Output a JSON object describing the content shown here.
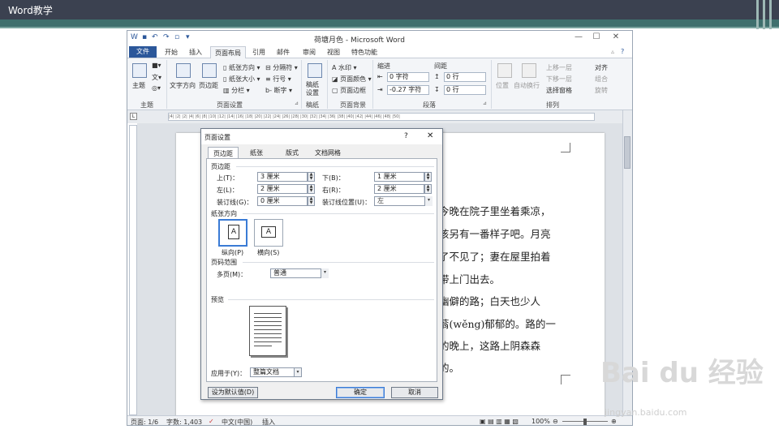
{
  "slide": {
    "title": "Word教学"
  },
  "word": {
    "window_title": "荷塘月色 - Microsoft Word",
    "tabs": [
      "文件",
      "开始",
      "插入",
      "页面布局",
      "引用",
      "邮件",
      "审阅",
      "视图",
      "特色功能"
    ],
    "active_tab": "页面布局",
    "ribbon": {
      "theme": {
        "themes": "主题",
        "group": "主题"
      },
      "page_setup": {
        "text_direction": "文字方向",
        "margins": "页边距",
        "orientation": "纸张方向",
        "size": "纸张大小",
        "columns": "分栏",
        "breaks": "分隔符",
        "line_numbers": "行号",
        "hyphenation": "断字",
        "group": "页面设置"
      },
      "draft": {
        "draft_settings": "稿纸设置",
        "group": "稿纸"
      },
      "background": {
        "watermark": "水印",
        "page_color": "页面颜色",
        "page_borders": "页面边框",
        "group": "页面背景"
      },
      "paragraph": {
        "indent": "缩进",
        "spacing": "间距",
        "left_indent": "0 字符",
        "right_indent": "-0.27 字符",
        "before": "0 行",
        "after": "0 行",
        "group": "段落"
      },
      "arrange": {
        "position": "位置",
        "wrap": "自动换行",
        "bring_forward": "上移一层",
        "send_backward": "下移一层",
        "selection_pane": "选择窗格",
        "align": "对齐",
        "group_btn": "组合",
        "rotate": "旋转",
        "group": "排列"
      }
    },
    "ruler_text": "|4| |2| |2| |4| |6| |8| |10| |12| |14| |16| |18| |20| |22| |24| |26| |28| |30| |32| |34| |36| |38| |40| |42| |44| |46| |48| |50|",
    "doc_lines": [
      "今晚在院子里坐着乘凉，",
      "该另有一番样子吧。月亮",
      "了不见了；妻在屋里拍着",
      "带上门出去。",
      "幽僻的路；白天也少人",
      "蓊(wěng)郁郁的。路的一",
      "的晚上，这路上阴森森",
      "的。"
    ],
    "status": {
      "page": "页面: 1/6",
      "words": "字数: 1,403",
      "language": "中文(中国)",
      "mode": "插入",
      "zoom": "100%"
    }
  },
  "dialog": {
    "title": "页面设置",
    "help": "?",
    "close": "✕",
    "tabs": [
      "页边距",
      "纸张",
      "版式",
      "文档网格"
    ],
    "margins_section": "页边距",
    "top_label": "上(T)：",
    "top_value": "3 厘米",
    "bottom_label": "下(B)：",
    "bottom_value": "1 厘米",
    "left_label": "左(L)：",
    "left_value": "2 厘米",
    "right_label": "右(R)：",
    "right_value": "2 厘米",
    "gutter_label": "装订线(G)：",
    "gutter_value": "0 厘米",
    "gutter_pos_label": "装订线位置(U)：",
    "gutter_pos_value": "左",
    "orientation_section": "纸张方向",
    "portrait": "纵向(P)",
    "landscape": "横向(S)",
    "pages_section": "页码范围",
    "multiple_label": "多页(M)：",
    "multiple_value": "普通",
    "preview_section": "预览",
    "apply_label": "应用于(Y)：",
    "apply_value": "整篇文档",
    "default_btn": "设为默认值(D)",
    "ok_btn": "确定",
    "cancel_btn": "取消"
  },
  "watermark": {
    "brand": "Bai du 经验",
    "url": "jingyan.baidu.com"
  }
}
